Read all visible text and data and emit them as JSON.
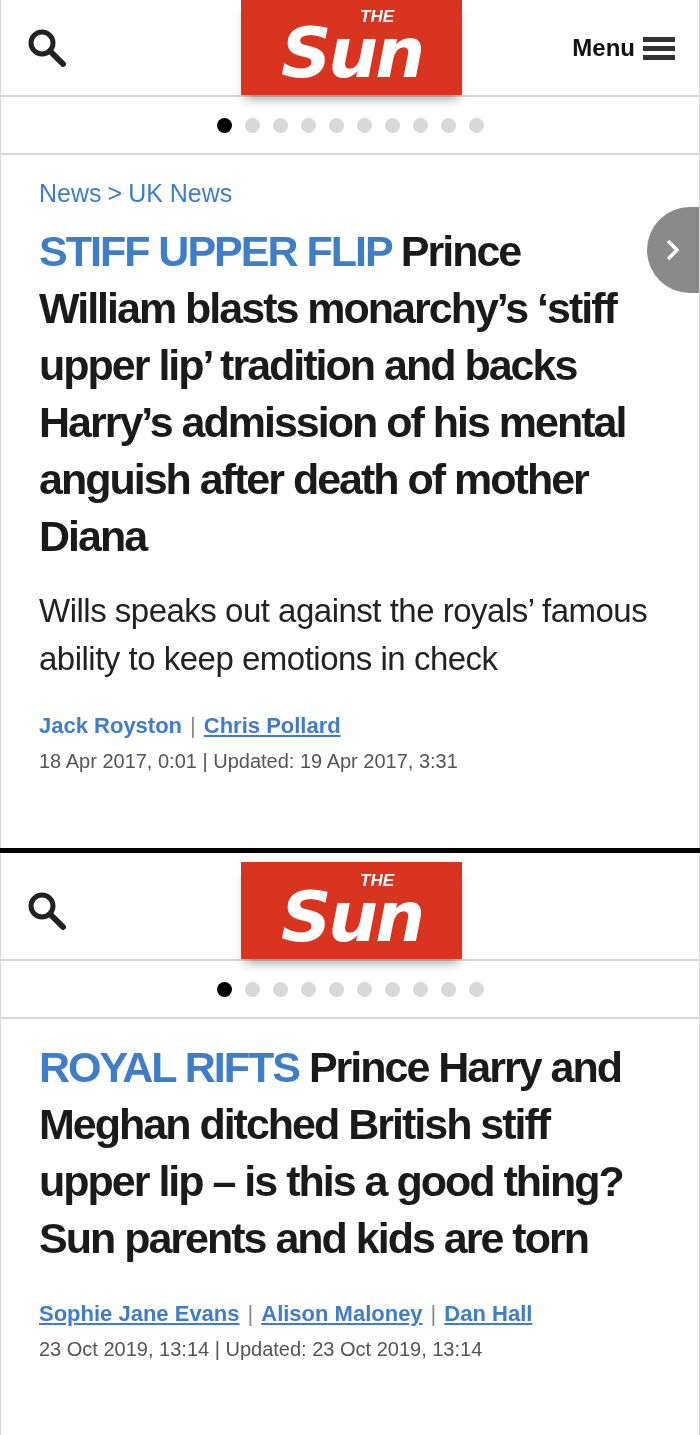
{
  "panels": [
    {
      "header": {
        "logo_small": "THE",
        "logo_large": "Sun",
        "menu_label": "Menu"
      },
      "dots": [
        {
          "selected": true
        },
        {
          "selected": false
        },
        {
          "selected": false
        },
        {
          "selected": false
        },
        {
          "selected": false
        },
        {
          "selected": false
        },
        {
          "selected": false
        },
        {
          "selected": false
        },
        {
          "selected": false
        },
        {
          "selected": false
        }
      ],
      "breadcrumb": {
        "items": [
          "News",
          "UK News"
        ],
        "separator": ">"
      },
      "next_button": true,
      "headline": {
        "kicker": "STIFF UPPER FLIP",
        "text": "Prince William blasts monarchy’s ‘stiff upper lip’ tradition and backs Harry’s admission of his mental anguish after death of mother Diana"
      },
      "standfirst": "Wills speaks out against the royals’ famous ability to keep emotions in check",
      "byline": {
        "separator": "|",
        "authors": [
          {
            "name": "Jack Royston",
            "linked": false
          },
          {
            "name": "Chris Pollard",
            "linked": true
          }
        ]
      },
      "dateline": "18 Apr 2017, 0:01 | Updated: 19 Apr 2017, 3:31"
    },
    {
      "header": {
        "logo_small": "THE",
        "logo_large": "Sun"
      },
      "dots": [
        {
          "selected": true
        },
        {
          "selected": false
        },
        {
          "selected": false
        },
        {
          "selected": false
        },
        {
          "selected": false
        },
        {
          "selected": false
        },
        {
          "selected": false
        },
        {
          "selected": false
        },
        {
          "selected": false
        },
        {
          "selected": false
        }
      ],
      "next_button": false,
      "headline": {
        "kicker": "ROYAL RIFTS",
        "text": "Prince Harry and Meghan ditched British stiff upper lip – is this a good thing? Sun parents and kids are torn"
      },
      "byline": {
        "separator": "|",
        "authors": [
          {
            "name": "Sophie Jane Evans",
            "linked": true
          },
          {
            "name": "Alison Maloney",
            "linked": true
          },
          {
            "name": "Dan Hall",
            "linked": true
          }
        ]
      },
      "dateline": "23 Oct 2019, 13:14 | Updated: 23 Oct 2019, 13:14"
    }
  ]
}
